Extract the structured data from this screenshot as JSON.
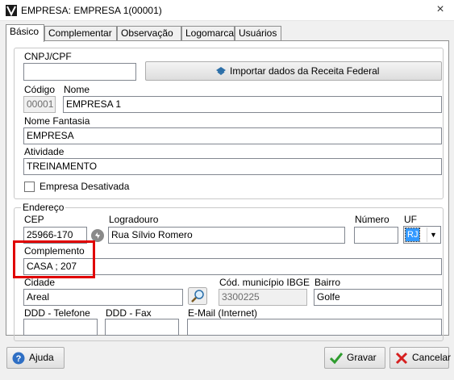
{
  "window": {
    "title": "EMPRESA: EMPRESA 1(00001)",
    "close_glyph": "×"
  },
  "tabs": [
    {
      "label": "Básico",
      "active": true
    },
    {
      "label": "Complementar",
      "active": false
    },
    {
      "label": "Observação",
      "active": false
    },
    {
      "label": "Logomarca",
      "active": false
    },
    {
      "label": "Usuários",
      "active": false
    }
  ],
  "basico": {
    "cnpj_label": "CNPJ/CPF",
    "cnpj_value": "",
    "import_button": "Importar dados da Receita Federal",
    "codigo_label": "Código",
    "codigo_value": "00001",
    "nome_label": "Nome",
    "nome_value": "EMPRESA 1",
    "fantasia_label": "Nome Fantasia",
    "fantasia_value": "EMPRESA",
    "atividade_label": "Atividade",
    "atividade_value": "TREINAMENTO",
    "desativada_label": "Empresa Desativada",
    "desativada_checked": false
  },
  "endereco": {
    "legend": "Endereço",
    "cep_label": "CEP",
    "cep_value": "25966-170",
    "logradouro_label": "Logradouro",
    "logradouro_value": "Rua Sílvio Romero",
    "numero_label": "Número",
    "numero_value": "",
    "uf_label": "UF",
    "uf_value": "RJ",
    "complemento_label": "Complemento",
    "complemento_value": "CASA ; 207",
    "cidade_label": "Cidade",
    "cidade_value": "Areal",
    "ibge_label": "Cód. município IBGE",
    "ibge_value": "3300225",
    "bairro_label": "Bairro",
    "bairro_value": "Golfe",
    "ddd_telefone_label": "DDD - Telefone",
    "ddd_telefone_value": "",
    "ddd_fax_label": "DDD - Fax",
    "ddd_fax_value": "",
    "email_label": "E-Mail (Internet)",
    "email_value": ""
  },
  "buttons": {
    "ajuda": "Ajuda",
    "gravar": "Gravar",
    "cancelar": "Cancelar"
  },
  "colors": {
    "highlight": "#e00000",
    "selection": "#3399ff"
  }
}
